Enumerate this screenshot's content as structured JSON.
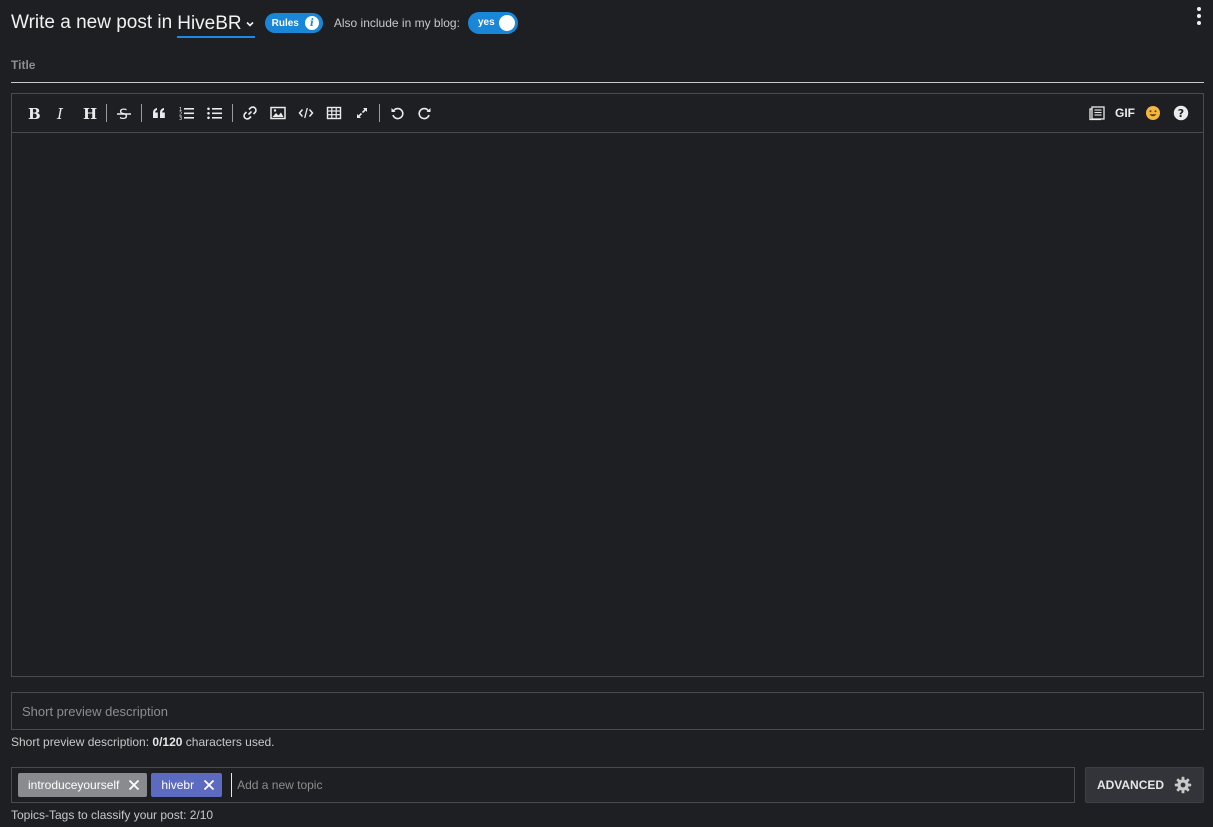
{
  "header": {
    "title_prefix": "Write a new post in",
    "community": "HiveBR",
    "rules_label": "Rules",
    "blog_label": "Also include in my blog:",
    "toggle_label": "yes"
  },
  "title_field": {
    "placeholder": "Title",
    "value": ""
  },
  "toolbar": {
    "left_icons": [
      "bold-icon",
      "italic-icon",
      "heading-icon",
      "strikethrough-icon",
      "quote-icon",
      "ordered-list-icon",
      "unordered-list-icon",
      "link-icon",
      "image-icon",
      "code-icon",
      "table-icon",
      "fullscreen-icon",
      "undo-icon",
      "redo-icon"
    ],
    "gif_label": "GIF",
    "right_icons": [
      "snippets-icon",
      "gif-icon",
      "emoji-icon",
      "help-icon"
    ]
  },
  "description": {
    "placeholder": "Short preview description",
    "hint_prefix": "Short preview description:",
    "hint_count": "0/120",
    "hint_suffix": "characters used."
  },
  "tags": {
    "items": [
      {
        "label": "introduceyourself",
        "color": "#898b8e"
      },
      {
        "label": "hivebr",
        "color": "#5c6bc0"
      }
    ],
    "placeholder": "Add a new topic",
    "hint": "Topics-Tags to classify your post: 2/10"
  },
  "advanced": {
    "label": "ADVANCED"
  },
  "colors": {
    "accent": "#1a86d8",
    "background": "#1e1f22",
    "border": "#4a4b4f"
  }
}
